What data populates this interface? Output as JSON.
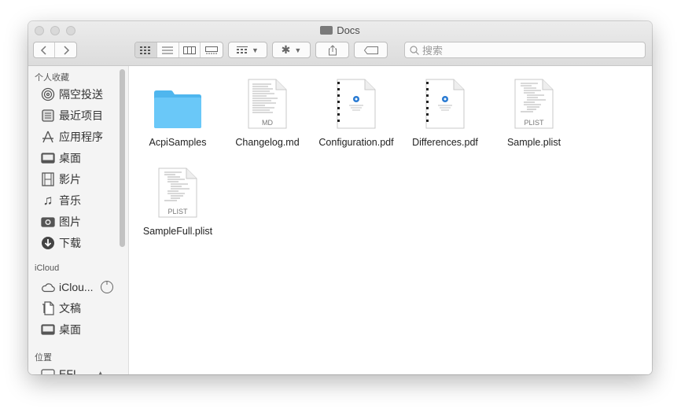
{
  "window": {
    "title": "Docs"
  },
  "toolbar": {
    "search_placeholder": "搜索"
  },
  "sidebar": {
    "sections": [
      {
        "header": "个人收藏",
        "items": [
          {
            "label": "隔空投送",
            "icon": "airdrop-icon"
          },
          {
            "label": "最近项目",
            "icon": "recents-icon"
          },
          {
            "label": "应用程序",
            "icon": "applications-icon"
          },
          {
            "label": "桌面",
            "icon": "desktop-icon"
          },
          {
            "label": "影片",
            "icon": "movies-icon"
          },
          {
            "label": "音乐",
            "icon": "music-icon"
          },
          {
            "label": "图片",
            "icon": "pictures-icon"
          },
          {
            "label": "下载",
            "icon": "downloads-icon"
          }
        ]
      },
      {
        "header": "iCloud",
        "items": [
          {
            "label": "iClou...",
            "icon": "icloud-icon"
          },
          {
            "label": "文稿",
            "icon": "documents-icon"
          },
          {
            "label": "桌面",
            "icon": "desktop-icon"
          }
        ]
      },
      {
        "header": "位置",
        "items": [
          {
            "label": "EFI",
            "icon": "disk-icon"
          }
        ]
      }
    ]
  },
  "files": [
    {
      "name": "AcpiSamples",
      "kind": "folder"
    },
    {
      "name": "Changelog.md",
      "kind": "md",
      "badge": "MD"
    },
    {
      "name": "Configuration.pdf",
      "kind": "pdf"
    },
    {
      "name": "Differences.pdf",
      "kind": "pdf"
    },
    {
      "name": "Sample.plist",
      "kind": "plist",
      "badge": "PLIST"
    },
    {
      "name": "SampleFull.plist",
      "kind": "plist",
      "badge": "PLIST"
    }
  ],
  "colors": {
    "folder": "#5bc0f5",
    "accent": "#2a7bd3"
  }
}
